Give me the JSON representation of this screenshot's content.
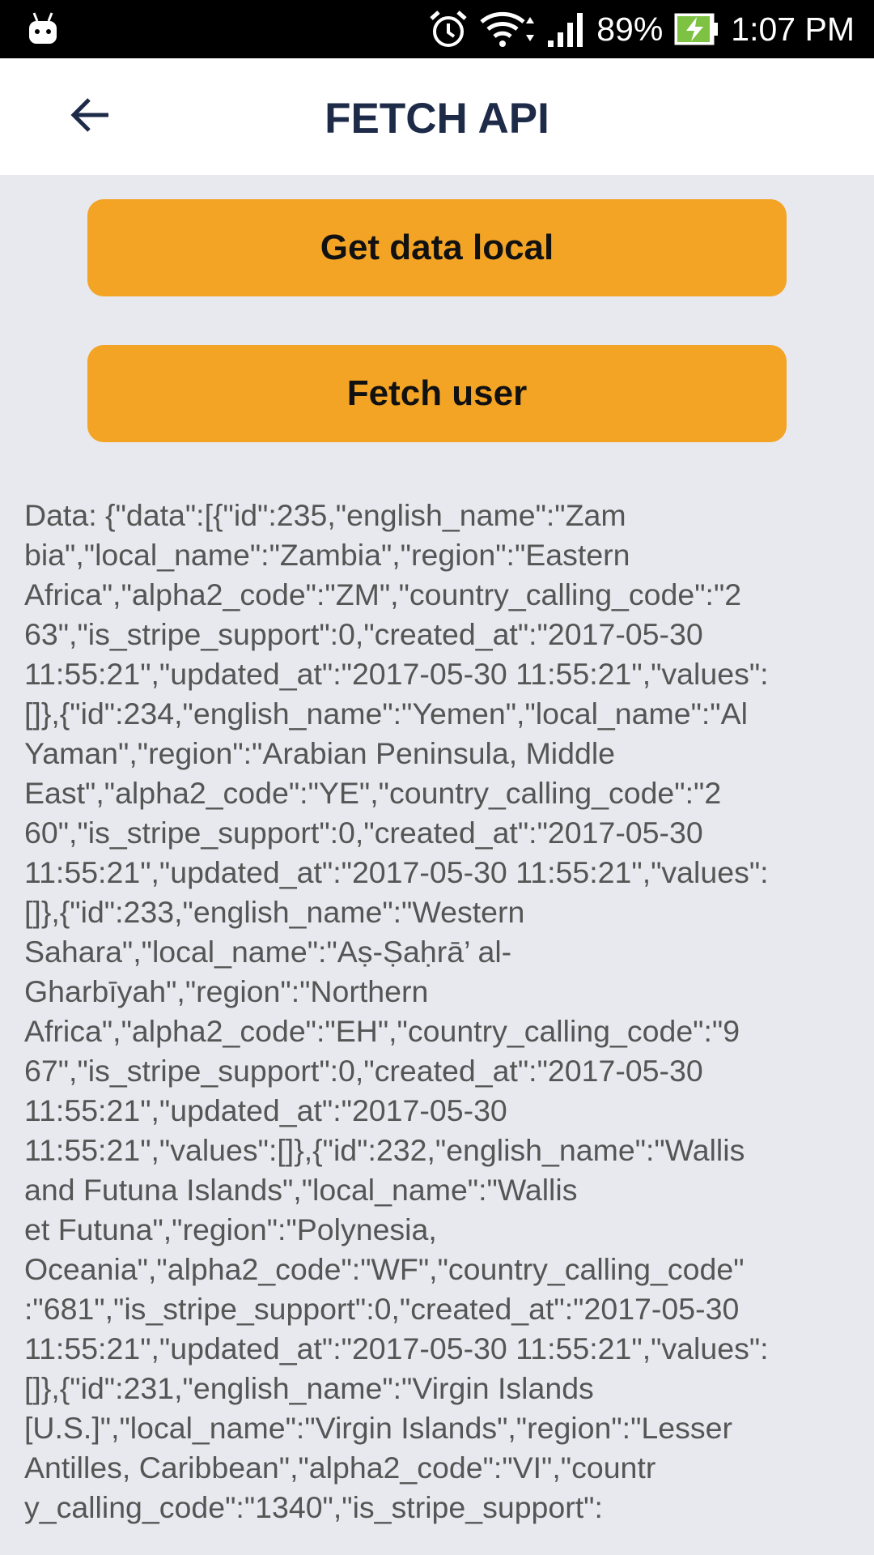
{
  "status_bar": {
    "left_icon": "android-debug-icon",
    "icons": [
      "alarm-icon",
      "wifi-icon",
      "signal-icon",
      "battery-charging-icon"
    ],
    "battery_percent": "89%",
    "time": "1:07 PM"
  },
  "app_bar": {
    "back_icon": "arrow-back-icon",
    "title": "FETCH API"
  },
  "buttons": {
    "get_local_label": "Get data local",
    "fetch_user_label": "Fetch user"
  },
  "colors": {
    "accent": "#f3a425",
    "background": "#e8e9ef",
    "title": "#1d2b48",
    "text": "#555555"
  },
  "content": {
    "lines": [
      "Data: {\"data\":[{\"id\":235,\"english_name\":\"Zam",
      "bia\",\"local_name\":\"Zambia\",\"region\":\"Eastern",
      "Africa\",\"alpha2_code\":\"ZM\",\"country_calling_code\":\"2",
      "63\",\"is_stripe_support\":0,\"created_at\":\"2017-05-30",
      "11:55:21\",\"updated_at\":\"2017-05-30 11:55:21\",\"values\":",
      "[]},{\"id\":234,\"english_name\":\"Yemen\",\"local_name\":\"Al",
      "Yaman\",\"region\":\"Arabian Peninsula, Middle",
      "East\",\"alpha2_code\":\"YE\",\"country_calling_code\":\"2",
      "60\",\"is_stripe_support\":0,\"created_at\":\"2017-05-30",
      "11:55:21\",\"updated_at\":\"2017-05-30 11:55:21\",\"values\":",
      "[]},{\"id\":233,\"english_name\":\"Western",
      "Sahara\",\"local_name\":\"Aṣ-Ṣaḥrā’ al-",
      "Gharbīyah\",\"region\":\"Northern",
      "Africa\",\"alpha2_code\":\"EH\",\"country_calling_code\":\"9",
      "67\",\"is_stripe_support\":0,\"created_at\":\"2017-05-30",
      "11:55:21\",\"updated_at\":\"2017-05-30",
      "11:55:21\",\"values\":[]},{\"id\":232,\"english_name\":\"Wallis",
      "and Futuna Islands\",\"local_name\":\"Wallis",
      "et Futuna\",\"region\":\"Polynesia,",
      "Oceania\",\"alpha2_code\":\"WF\",\"country_calling_code\"",
      ":\"681\",\"is_stripe_support\":0,\"created_at\":\"2017-05-30",
      "11:55:21\",\"updated_at\":\"2017-05-30 11:55:21\",\"values\":",
      "[]},{\"id\":231,\"english_name\":\"Virgin Islands",
      "[U.S.]\",\"local_name\":\"Virgin Islands\",\"region\":\"Lesser",
      "Antilles, Caribbean\",\"alpha2_code\":\"VI\",\"countr",
      "y_calling_code\":\"1340\",\"is_stripe_support\":"
    ]
  }
}
